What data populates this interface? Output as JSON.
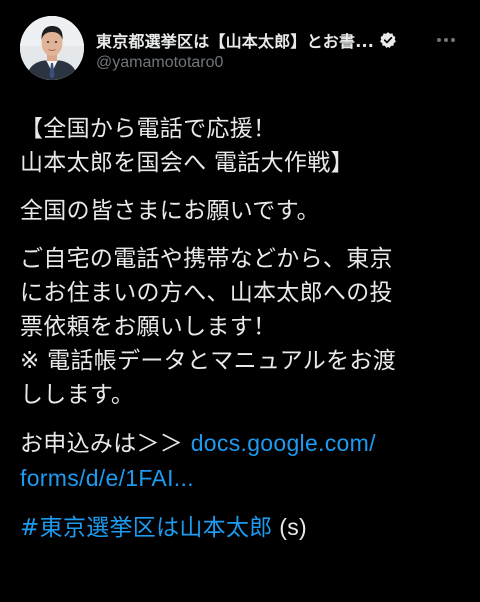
{
  "tweet_header": {
    "display_name": "東京都選挙区は【山本太郎】とお書...",
    "handle": "@yamamototaro0",
    "verified_icon": "verified-badge-icon",
    "more_icon": "more-options-icon"
  },
  "tweet": {
    "para1": {
      "line1": "【全国から電話で応援！",
      "line2": "山本太郎を国会へ 電話大作戦】"
    },
    "para2": {
      "line1": "全国の皆さまにお願いです。"
    },
    "para3": {
      "line1": "ご自宅の電話や携帯などから、東京",
      "line2": "にお住まいの方へ、山本太郎への投",
      "line3": "票依頼をお願いします！",
      "line4": "※ 電話帳データとマニュアルをお渡",
      "line5": "しします。"
    },
    "para4": {
      "prefix": "お申込みは＞＞ ",
      "link_part1": "docs.google.com/",
      "link_part2": "forms/d/e/1FAI..."
    },
    "hashtag": "#東京選挙区は山本太郎",
    "hashtag_suffix": " (s)"
  },
  "colors": {
    "background": "#000000",
    "text": "#e7e9ea",
    "secondary_text": "#71767b",
    "link": "#1d9bf0"
  }
}
